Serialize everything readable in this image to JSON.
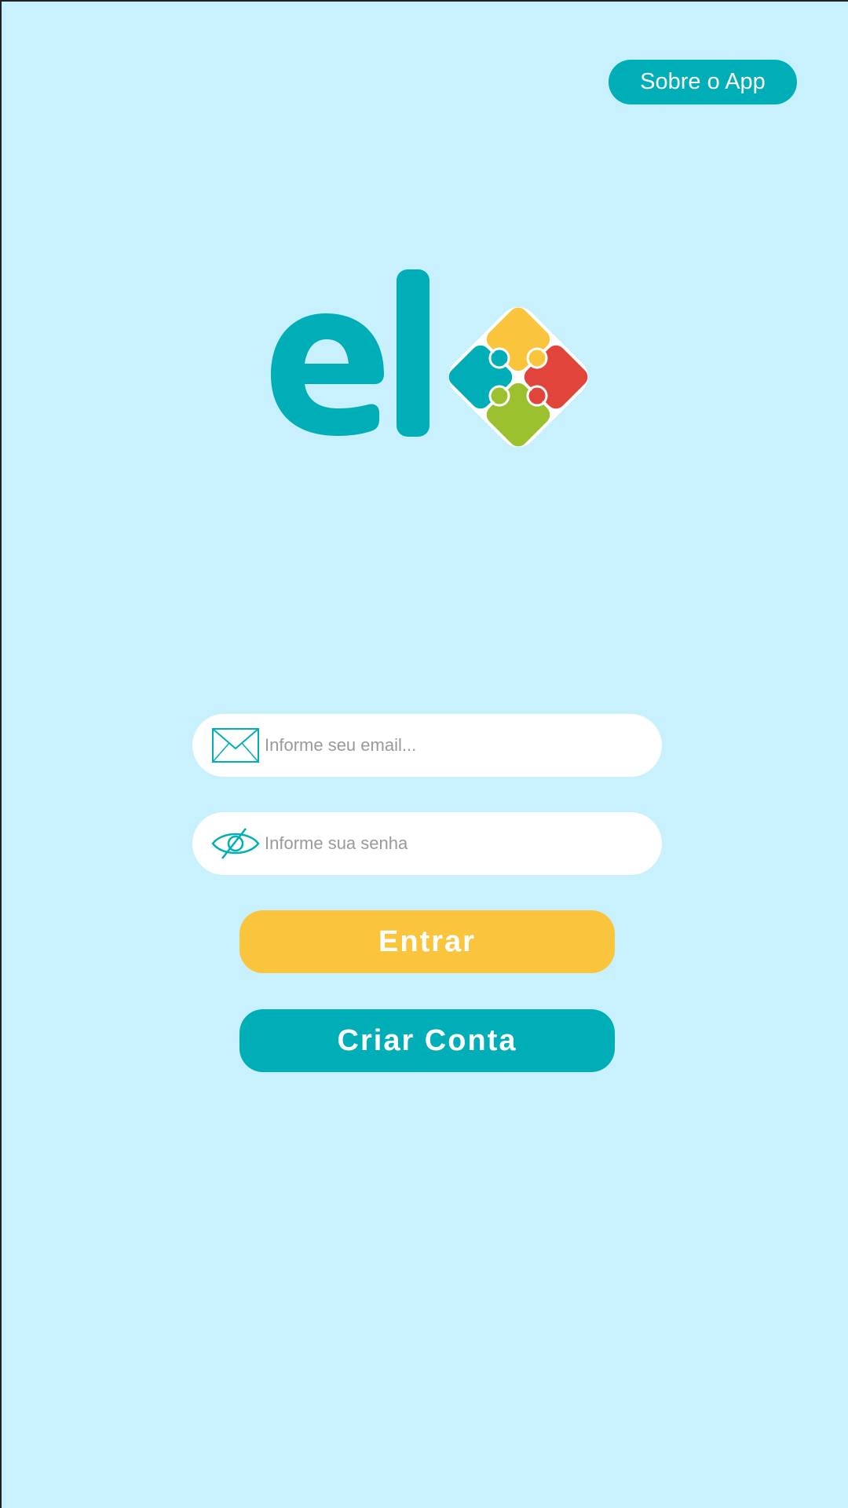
{
  "header": {
    "about_label": "Sobre o App"
  },
  "logo": {
    "text": "el",
    "icon": "puzzle-diamond-icon",
    "colors": {
      "text": "#00AEB7",
      "yellow": "#FAC43C",
      "red": "#E0443A",
      "green": "#9BC12E",
      "teal": "#00AEB7"
    }
  },
  "form": {
    "email": {
      "icon": "envelope-icon",
      "placeholder": "Informe seu email...",
      "value": ""
    },
    "password": {
      "icon": "eye-off-icon",
      "placeholder": "Informe sua senha",
      "value": ""
    },
    "login_label": "Entrar",
    "register_label": "Criar Conta"
  },
  "colors": {
    "background": "#C8F0FD",
    "primary": "#00AEB7",
    "accent": "#FAC43C",
    "field_bg": "#FFFFFF"
  }
}
